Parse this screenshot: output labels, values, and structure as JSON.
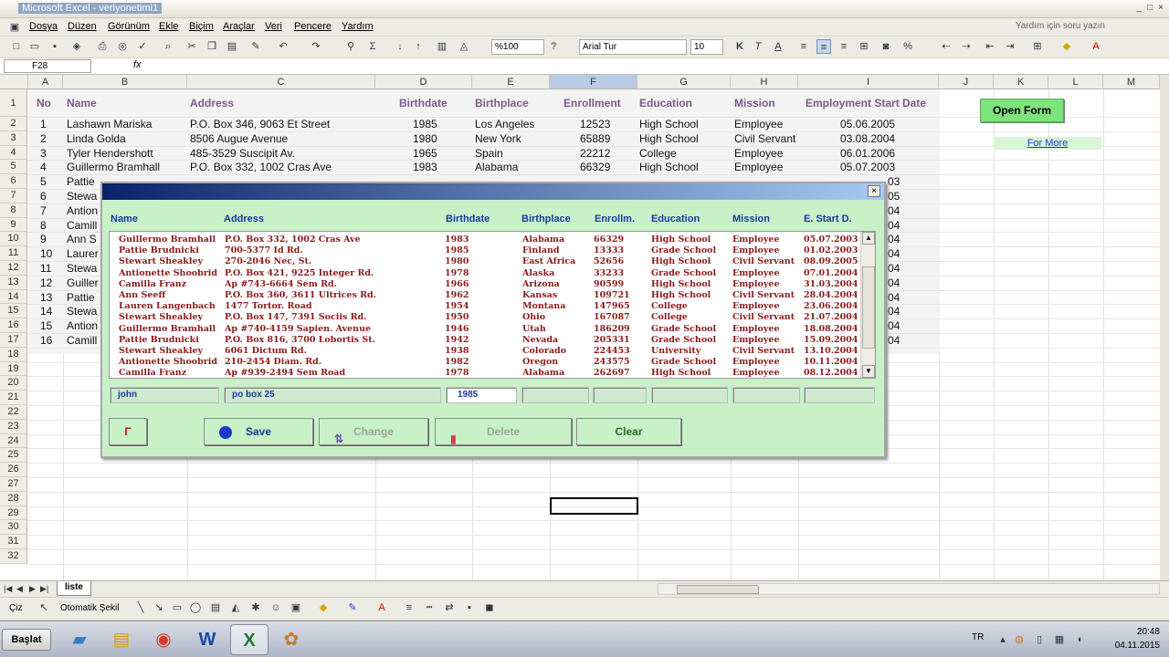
{
  "window": {
    "title": "Microsoft Excel - veriyonetimi1",
    "min": "_",
    "max": "□",
    "close": "×"
  },
  "menu": {
    "items": [
      "Dosya",
      "Düzen",
      "Görünüm",
      "Ekle",
      "Biçim",
      "Araçlar",
      "Veri",
      "Pencere",
      "Yardım"
    ],
    "help_placeholder": "Yardım için soru yazın"
  },
  "toolbar": {
    "zoom": "%100",
    "font": "Arial Tur",
    "size": "10",
    "bold": "K",
    "italic": "T",
    "underline": "A",
    "percent": "%"
  },
  "formula": {
    "cell": "F28",
    "fx": "fx"
  },
  "columns": [
    "A",
    "B",
    "C",
    "D",
    "E",
    "F",
    "G",
    "H",
    "I",
    "J",
    "K",
    "L",
    "M"
  ],
  "rows": [
    "1",
    "2",
    "3",
    "4",
    "5",
    "6",
    "7",
    "8",
    "9",
    "10",
    "11",
    "12",
    "13",
    "14",
    "15",
    "16",
    "17",
    "18",
    "19",
    "20",
    "21",
    "22",
    "23",
    "24",
    "25",
    "26",
    "27",
    "28",
    "29",
    "30",
    "31",
    "32"
  ],
  "sheet_headers": [
    "No",
    "Name",
    "Address",
    "Birthdate",
    "Birthplace",
    "Enrollment",
    "Education",
    "Mission",
    "Employment Start Date"
  ],
  "sheet_rows": [
    {
      "no": "1",
      "name": "Lashawn Mariska",
      "address": "P.O. Box 346, 9063 Et Street",
      "birth": "1985",
      "place": "Los Angeles",
      "enroll": "12523",
      "edu": "High School",
      "mission": "Employee",
      "start": "05.06.2005"
    },
    {
      "no": "2",
      "name": "Linda Golda",
      "address": "8506 Augue Avenue",
      "birth": "1980",
      "place": "New York",
      "enroll": "65889",
      "edu": "High School",
      "mission": "Civil Servant",
      "start": "03.08.2004"
    },
    {
      "no": "3",
      "name": "Tyler Hendershott",
      "address": "485-3529 Suscipit Av.",
      "birth": "1965",
      "place": "Spain",
      "enroll": "22212",
      "edu": "College",
      "mission": "Employee",
      "start": "06.01.2006"
    },
    {
      "no": "4",
      "name": "Guillermo Bramhall",
      "address": "P.O. Box 332, 1002 Cras Ave",
      "birth": "1983",
      "place": "Alabama",
      "enroll": "66329",
      "edu": "High School",
      "mission": "Employee",
      "start": "05.07.2003"
    }
  ],
  "partial_rows": [
    {
      "no": "5",
      "name": "Pattie",
      "end": "03"
    },
    {
      "no": "6",
      "name": "Stewa",
      "end": "05"
    },
    {
      "no": "7",
      "name": "Antion",
      "end": "04"
    },
    {
      "no": "8",
      "name": "Camill",
      "end": "04"
    },
    {
      "no": "9",
      "name": "Ann S",
      "end": "04"
    },
    {
      "no": "10",
      "name": "Laurer",
      "end": "04"
    },
    {
      "no": "11",
      "name": "Stewa",
      "end": "04"
    },
    {
      "no": "12",
      "name": "Guiller",
      "end": "04"
    },
    {
      "no": "13",
      "name": "Pattie",
      "end": "04"
    },
    {
      "no": "14",
      "name": "Stewa",
      "end": "04"
    },
    {
      "no": "15",
      "name": "Antion",
      "end": "04"
    },
    {
      "no": "16",
      "name": "Camill",
      "end": "04"
    }
  ],
  "side": {
    "open_form": "Open Form",
    "for_more": "For More"
  },
  "dialog": {
    "close": "×",
    "headers": [
      "Name",
      "Address",
      "Birthdate",
      "Birthplace",
      "Enrollm.",
      "Education",
      "Mission",
      "E. Start D."
    ],
    "list": [
      [
        "Guillermo Bramhall",
        "P.O. Box 332, 1002 Cras Ave",
        "1983",
        "Alabama",
        "66329",
        "High School",
        "Employee",
        "05.07.2003"
      ],
      [
        "Pattie Brudnicki",
        "700-5377 Id Rd.",
        "1985",
        "Finland",
        "13333",
        "Grade School",
        "Employee",
        "01.02.2003"
      ],
      [
        "Stewart Sheakley",
        "270-2046 Nec, St.",
        "1980",
        "East Africa",
        "52656",
        "High School",
        "Civil Servant",
        "08.09.2005"
      ],
      [
        "Antionette Shoobrid",
        "P.O. Box 421, 9225 Integer Rd.",
        "1978",
        "Alaska",
        "33233",
        "Grade School",
        "Employee",
        "07.01.2004"
      ],
      [
        "Camilla Franz",
        "Ap #743-6664 Sem Rd.",
        "1966",
        "Arizona",
        "90599",
        "High School",
        "Employee",
        "31.03.2004"
      ],
      [
        "Ann Seeff",
        "P.O. Box 360, 3611 Ultrices Rd.",
        "1962",
        "Kansas",
        "109721",
        "High School",
        "Civil Servant",
        "28.04.2004"
      ],
      [
        "Lauren Langenbach",
        "1477 Tortor. Road",
        "1954",
        "Montana",
        "147965",
        "College",
        "Employee",
        "23.06.2004"
      ],
      [
        "Stewart Sheakley",
        "P.O. Box 147, 7391 Sociis Rd.",
        "1950",
        "Ohio",
        "167087",
        "College",
        "Civil Servant",
        "21.07.2004"
      ],
      [
        "Guillermo Bramhall",
        "Ap #740-4159 Sapien. Avenue",
        "1946",
        "Utah",
        "186209",
        "Grade School",
        "Employee",
        "18.08.2004"
      ],
      [
        "Pattie Brudnicki",
        "P.O. Box 816, 3700 Lobortis St.",
        "1942",
        "Nevada",
        "205331",
        "Grade School",
        "Employee",
        "15.09.2004"
      ],
      [
        "Stewart Sheakley",
        "6061 Dictum Rd.",
        "1938",
        "Colorado",
        "224453",
        "University",
        "Civil Servant",
        "13.10.2004"
      ],
      [
        "Antionette Shoobrid",
        "210-2454 Diam. Rd.",
        "1982",
        "Oregon",
        "243575",
        "Grade School",
        "Employee",
        "10.11.2004"
      ],
      [
        "Camilla Franz",
        "Ap #939-2494 Sem Road",
        "1978",
        "Alabama",
        "262697",
        "High School",
        "Employee",
        "08.12.2004"
      ]
    ],
    "inputs": {
      "name": "john",
      "address": "po box 25",
      "birth": "1985",
      "place": "",
      "enroll": "",
      "edu": "",
      "mission": "",
      "start": ""
    },
    "buttons": {
      "save": "Save",
      "change": "Change",
      "delete": "Delete",
      "clear": "Clear"
    }
  },
  "tabs": {
    "sheet": "liste"
  },
  "draw": {
    "draw": "Çiz",
    "autoshapes": "Otomatik Şekil"
  },
  "taskbar": {
    "start": "Başlat",
    "lang": "TR",
    "time": "20:48",
    "date": "04.11.2015"
  }
}
